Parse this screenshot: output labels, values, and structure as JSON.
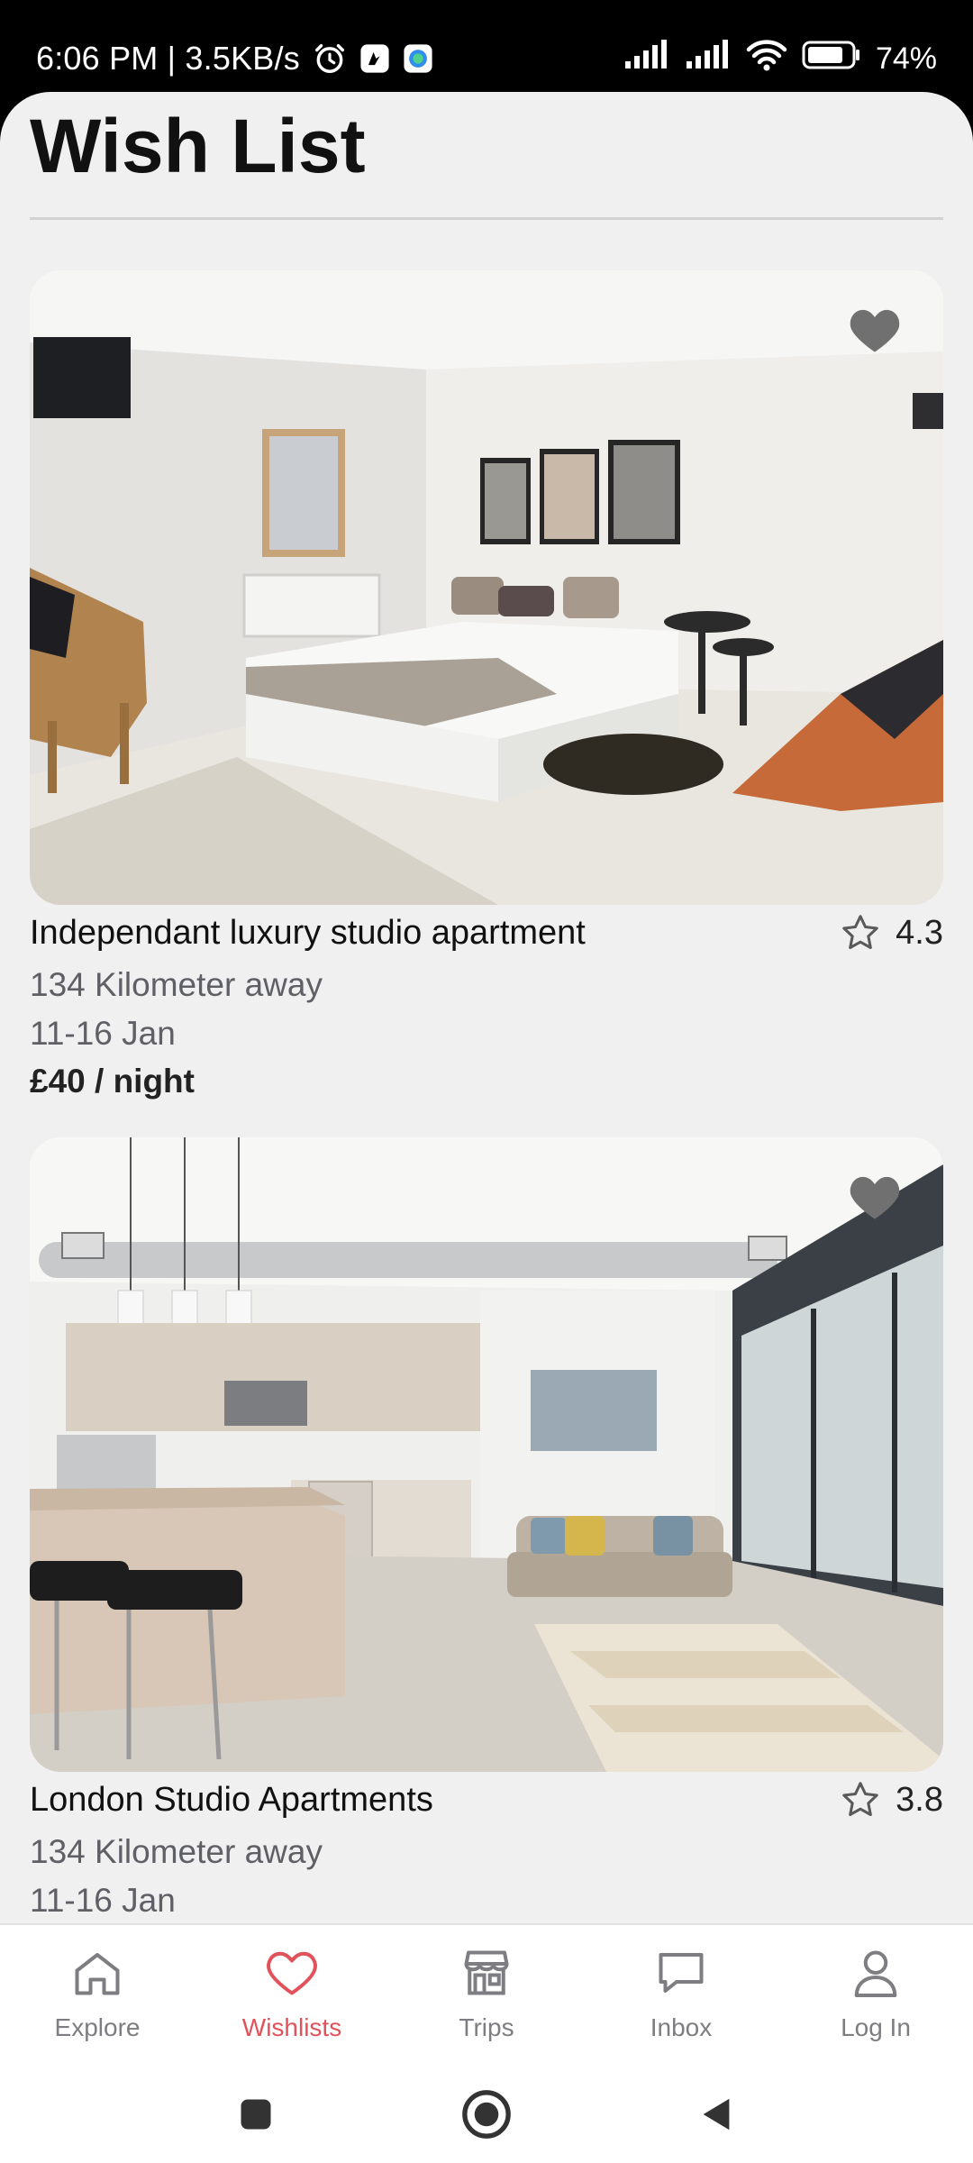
{
  "status_bar": {
    "time_info": "6:06 PM | 3.5KB/s",
    "battery": "74%"
  },
  "header": {
    "title": "Wish List"
  },
  "listings": [
    {
      "title": "Independant luxury studio apartment",
      "rating": "4.3",
      "distance": "134 Kilometer away",
      "dates": "11-16 Jan",
      "price": "£40 / night"
    },
    {
      "title": "London Studio Apartments",
      "rating": "3.8",
      "distance": "134 Kilometer away",
      "dates": "11-16 Jan"
    }
  ],
  "bottom_nav": {
    "items": [
      {
        "label": "Explore",
        "icon": "home-icon"
      },
      {
        "label": "Wishlists",
        "icon": "heart-icon",
        "active": true
      },
      {
        "label": "Trips",
        "icon": "store-icon"
      },
      {
        "label": "Inbox",
        "icon": "chat-icon"
      },
      {
        "label": "Log In",
        "icon": "person-icon"
      }
    ]
  },
  "colors": {
    "accent": "#e2525b",
    "inactive": "#7d7d82",
    "background": "#f0f0f0"
  }
}
